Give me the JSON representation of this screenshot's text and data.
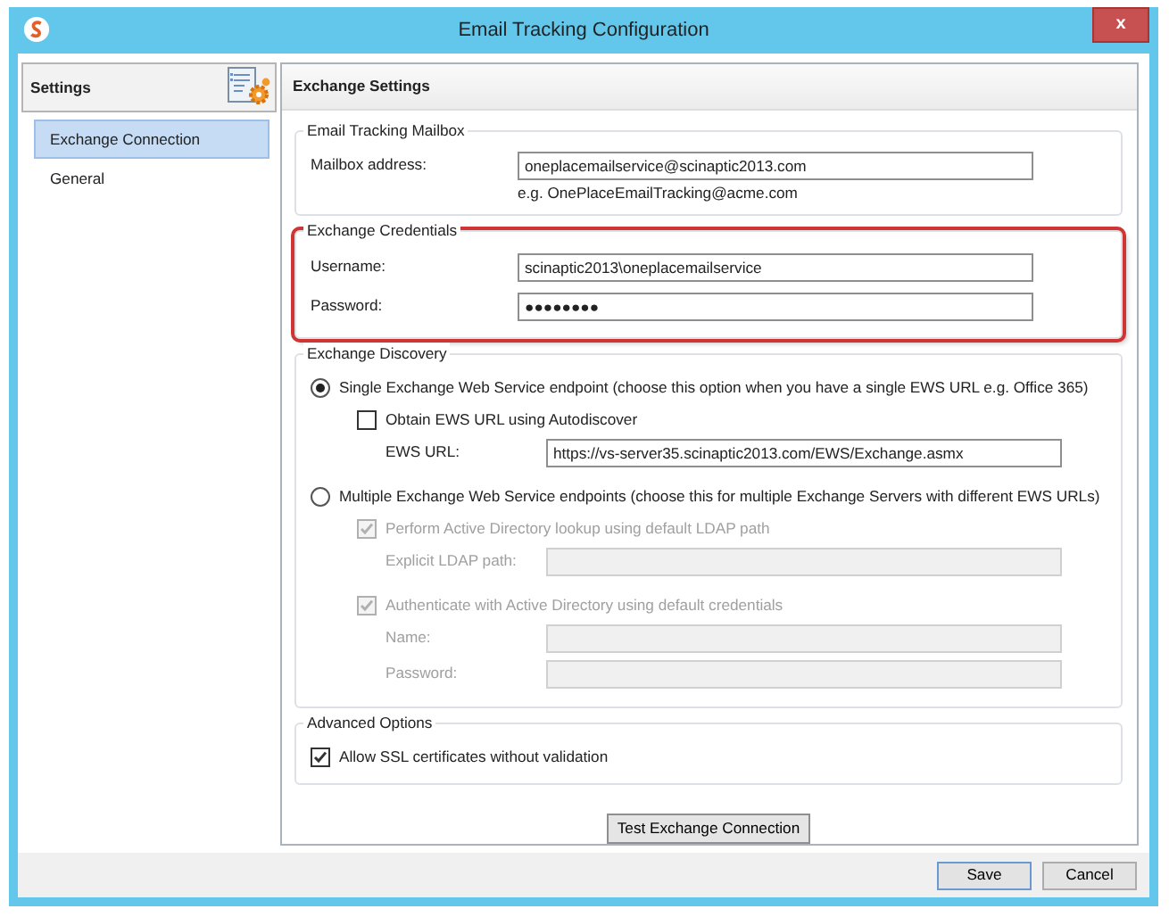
{
  "window": {
    "title": "Email Tracking Configuration",
    "close": "x"
  },
  "sidebar": {
    "header": "Settings",
    "items": [
      {
        "label": "Exchange Connection",
        "selected": true
      },
      {
        "label": "General",
        "selected": false
      }
    ]
  },
  "panel": {
    "title": "Exchange Settings"
  },
  "mailbox": {
    "title": "Email Tracking Mailbox",
    "fields": [
      {
        "label": "Mailbox address:",
        "value": "oneplacemailservice@scinaptic2013.com"
      }
    ],
    "hint": "e.g. OnePlaceEmailTracking@acme.com"
  },
  "credentials": {
    "title": "Exchange Credentials",
    "highlighted": true,
    "fields": [
      {
        "label": "Username:",
        "value": "scinaptic2013\\oneplacemailservice"
      },
      {
        "label": "Password:",
        "value": "●●●●●●●●"
      }
    ]
  },
  "discovery": {
    "title": "Exchange Discovery",
    "options": [
      {
        "label": "Single Exchange Web Service endpoint (choose this option when you have a single EWS URL e.g. Office 365)",
        "selected": true,
        "items": [
          {
            "kind": "checkbox",
            "label": "Obtain EWS URL using Autodiscover",
            "checked": false,
            "disabled": false
          },
          {
            "kind": "field",
            "label": "EWS URL:",
            "value": "https://vs-server35.scinaptic2013.com/EWS/Exchange.asmx",
            "disabled": false
          }
        ]
      },
      {
        "label": "Multiple Exchange Web Service endpoints (choose this for multiple Exchange Servers with different EWS URLs)",
        "selected": false,
        "items": [
          {
            "kind": "checkbox",
            "label": "Perform Active Directory lookup using default LDAP path",
            "checked": true,
            "disabled": true
          },
          {
            "kind": "field",
            "label": "Explicit LDAP path:",
            "disabled": true
          },
          {
            "kind": "checkbox",
            "label": "Authenticate with Active Directory using default credentials",
            "checked": true,
            "disabled": true
          },
          {
            "kind": "field",
            "label": "Name:",
            "disabled": true
          },
          {
            "kind": "field",
            "label": "Password:",
            "disabled": true
          }
        ]
      }
    ]
  },
  "advanced": {
    "title": "Advanced Options",
    "items": [
      {
        "kind": "checkbox",
        "label": "Allow SSL certificates without validation",
        "checked": true,
        "disabled": false
      }
    ]
  },
  "test_button": "Test Exchange Connection",
  "buttons": [
    {
      "label": "Save",
      "default": true
    },
    {
      "label": "Cancel",
      "default": false
    }
  ]
}
